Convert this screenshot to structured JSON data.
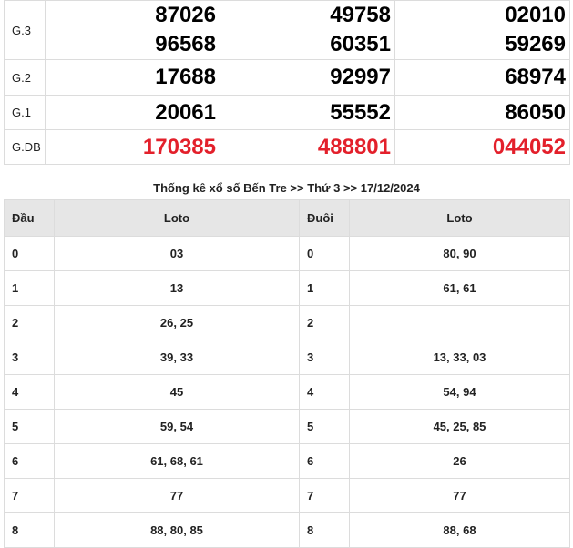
{
  "results": {
    "g3": {
      "label": "G.3",
      "numbers": [
        [
          "87026",
          "96568"
        ],
        [
          "49758",
          "60351"
        ],
        [
          "02010",
          "59269"
        ]
      ]
    },
    "g2": {
      "label": "G.2",
      "numbers": [
        "17688",
        "92997",
        "68974"
      ]
    },
    "g1": {
      "label": "G.1",
      "numbers": [
        "20061",
        "55552",
        "86050"
      ]
    },
    "gdb": {
      "label": "G.ĐB",
      "numbers": [
        "170385",
        "488801",
        "044052"
      ]
    }
  },
  "caption": "Thống kê xổ số Bến Tre >> Thứ 3 >> 17/12/2024",
  "loto": {
    "headers": [
      "Đầu",
      "Loto",
      "Đuôi",
      "Loto"
    ],
    "rows": [
      {
        "head": "0",
        "head_loto": "03",
        "tail": "0",
        "tail_loto": "80, 90"
      },
      {
        "head": "1",
        "head_loto": "13",
        "tail": "1",
        "tail_loto": "61, 61"
      },
      {
        "head": "2",
        "head_loto": "26, 25",
        "tail": "2",
        "tail_loto": ""
      },
      {
        "head": "3",
        "head_loto": "39, 33",
        "tail": "3",
        "tail_loto": "13, 33, 03"
      },
      {
        "head": "4",
        "head_loto": "45",
        "tail": "4",
        "tail_loto": "54, 94"
      },
      {
        "head": "5",
        "head_loto": "59, 54",
        "tail": "5",
        "tail_loto": "45, 25, 85"
      },
      {
        "head": "6",
        "head_loto": "61, 68, 61",
        "tail": "6",
        "tail_loto": "26"
      },
      {
        "head": "7",
        "head_loto": "77",
        "tail": "7",
        "tail_loto": "77"
      },
      {
        "head": "8",
        "head_loto": "88, 80, 85",
        "tail": "8",
        "tail_loto": "88, 68"
      }
    ]
  },
  "colors": {
    "special_prize": "#e3202b",
    "header_bg": "#e6e6e6",
    "border": "#dcdcdc"
  }
}
